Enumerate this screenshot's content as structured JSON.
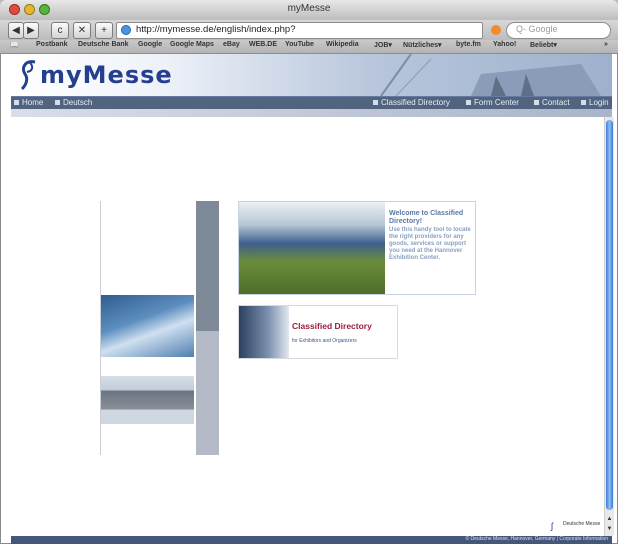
{
  "window": {
    "title": "myMesse"
  },
  "toolbar": {
    "back_icon": "back-arrow-icon",
    "forward_icon": "forward-arrow-icon",
    "reload_label": "c",
    "stop_label": "✕",
    "add_label": "+",
    "url": "http://mymesse.de/english/index.php?",
    "search_placeholder": "Q- Google"
  },
  "bookmarks": [
    {
      "label": "Postbank"
    },
    {
      "label": "Deutsche Bank"
    },
    {
      "label": "Google"
    },
    {
      "label": "Google Maps"
    },
    {
      "label": "eBay"
    },
    {
      "label": "WEB.DE"
    },
    {
      "label": "YouTube"
    },
    {
      "label": "Wikipedia"
    },
    {
      "label": "JOB▾"
    },
    {
      "label": "Nützliches▾"
    },
    {
      "label": "byte.fm"
    },
    {
      "label": "Yahoo!"
    },
    {
      "label": "Beliebt▾"
    }
  ],
  "site": {
    "logo": "myMesse",
    "nav_left": [
      {
        "label": "Home"
      },
      {
        "label": "Deutsch"
      }
    ],
    "nav_right": [
      {
        "label": "Classified Directory"
      },
      {
        "label": "Form Center"
      },
      {
        "label": "Contact"
      },
      {
        "label": "Login"
      }
    ],
    "welcome_title": "Welcome to Classified Directory!",
    "welcome_body": "Use this handy tool to locate the right providers for any goods, services or support you need at the Hannover Exhibition Center.",
    "directory_title": "Classified Directory",
    "directory_subtitle": "for Exhibitors and Organizers",
    "footer_logo_text": "Deutsche Messe",
    "footer_text": "© Deutsche Messe, Hannover, Germany | Corporate Information"
  },
  "colors": {
    "brand_blue": "#243f8f",
    "nav_bar": "#50637f",
    "directory_red": "#9a1d3d",
    "scroll_blue": "#3c7bd4"
  }
}
